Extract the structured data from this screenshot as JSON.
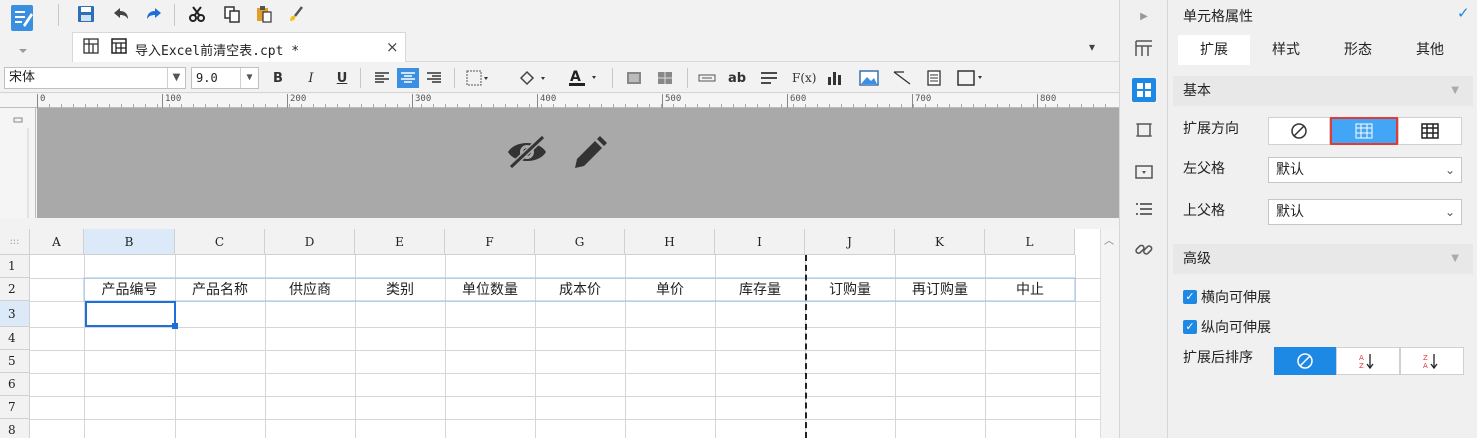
{
  "toolbar": {
    "icons": [
      "save-icon",
      "undo-icon",
      "redo-icon",
      "cut-icon",
      "copy-icon",
      "paste-icon",
      "format-brush-icon"
    ]
  },
  "tab": {
    "title": "导入Excel前清空表.cpt *",
    "close": "×"
  },
  "format": {
    "font": "宋体",
    "size": "9.0",
    "bold": "B",
    "italic": "I",
    "underline": "U",
    "text_button": "ab",
    "formula_button": "F(x)"
  },
  "ruler": {
    "marks": [
      "0",
      "100",
      "200",
      "300",
      "400",
      "500",
      "600",
      "700",
      "800"
    ]
  },
  "grid": {
    "corner": ":::",
    "columns": [
      "A",
      "B",
      "C",
      "D",
      "E",
      "F",
      "G",
      "H",
      "I",
      "J",
      "K",
      "L"
    ],
    "rows": [
      "1",
      "2",
      "3",
      "4",
      "5",
      "6",
      "7",
      "8"
    ],
    "row2": [
      "产品编号",
      "产品名称",
      "供应商",
      "类别",
      "单位数量",
      "成本价",
      "单价",
      "库存量",
      "订购量",
      "再订购量",
      "中止"
    ]
  },
  "panel": {
    "title": "单元格属性",
    "tabs": [
      "扩展",
      "样式",
      "形态",
      "其他"
    ],
    "basic": "基本",
    "expand_direction": "扩展方向",
    "left_parent": "左父格",
    "left_parent_value": "默认",
    "top_parent": "上父格",
    "top_parent_value": "默认",
    "advanced": "高级",
    "horizontal_expand": "横向可伸展",
    "vertical_expand": "纵向可伸展",
    "sort_after": "扩展后排序"
  },
  "colors": {
    "accent": "#1e88e5",
    "selected_border": "#e53935"
  }
}
